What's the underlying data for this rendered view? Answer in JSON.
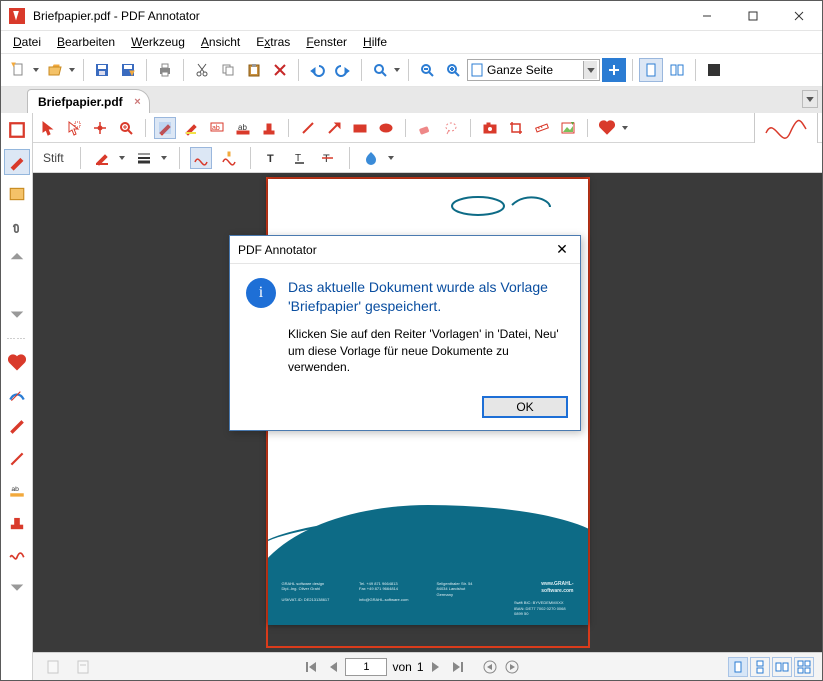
{
  "titlebar": {
    "title": "Briefpapier.pdf - PDF Annotator"
  },
  "menu": {
    "file": "Datei",
    "edit": "Bearbeiten",
    "tool": "Werkzeug",
    "view": "Ansicht",
    "extras": "Extras",
    "window": "Fenster",
    "help": "Hilfe"
  },
  "zoom": {
    "label": "Ganze Seite"
  },
  "tab": {
    "label": "Briefpapier.pdf"
  },
  "toolsub": {
    "stift": "Stift"
  },
  "dialog": {
    "title": "PDF Annotator",
    "main": "Das aktuelle Dokument wurde als Vorlage 'Briefpapier' gespeichert.",
    "sub": "Klicken Sie auf den Reiter 'Vorlagen' in 'Datei, Neu' um diese Vorlage für neue Dokumente zu verwenden.",
    "ok": "OK"
  },
  "page_footer": {
    "col1a": "GRAHL software design",
    "col1b": "Dipl.-Ing. Oliver Grahl",
    "col1c": "USt/VAT-ID: DE213138617",
    "col2a": "Tel. +49 871 9664813",
    "col2b": "Fax +49 871 9664814",
    "col2c": "info@GRAHL-software.com",
    "col3a": "Seligenthaler Str. 54",
    "col3b": "84034 Landshut",
    "col3c": "Germany",
    "col4a": "Swift BIC: BYVEDEMMXXX",
    "col4b": "IBAN: DE77 7002 0270 0068 0899 50",
    "url": "www.GRAHL-software.com"
  },
  "status": {
    "page": "1",
    "of_label": "von",
    "total": "1"
  }
}
